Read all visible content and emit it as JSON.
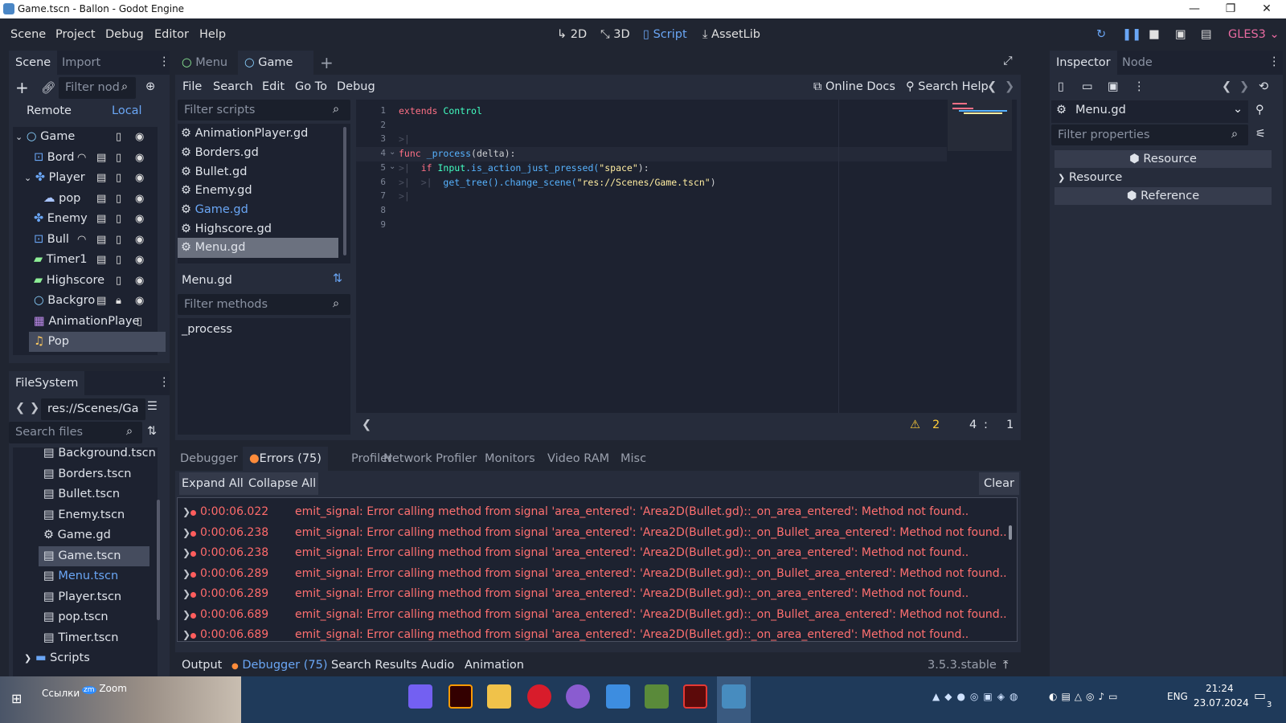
{
  "window": {
    "title": "Game.tscn - Ballon - Godot Engine",
    "minimize": "—",
    "restore": "❐",
    "close": "✕"
  },
  "menu": [
    "Scene",
    "Project",
    "Debug",
    "Editor",
    "Help"
  ],
  "workspaces": {
    "d2": "2D",
    "d3": "3D",
    "script": "Script",
    "assetlib": "AssetLib"
  },
  "renderer": "GLES3",
  "scene_dock": {
    "tab_scene": "Scene",
    "tab_import": "Import",
    "filter_placeholder": "Filter nod",
    "remote": "Remote",
    "local": "Local",
    "nodes": [
      {
        "name": "Game"
      },
      {
        "name": "Bord"
      },
      {
        "name": "Player"
      },
      {
        "name": "pop"
      },
      {
        "name": "Enemy"
      },
      {
        "name": "Bull"
      },
      {
        "name": "Timer1"
      },
      {
        "name": "Highscore"
      },
      {
        "name": "Backgro"
      },
      {
        "name": "AnimationPlaye"
      },
      {
        "name": "Pop"
      }
    ]
  },
  "filesystem": {
    "title": "FileSystem",
    "path": "res://Scenes/Ga",
    "search_placeholder": "Search files",
    "files": [
      "Background.tscn",
      "Borders.tscn",
      "Bullet.tscn",
      "Enemy.tscn",
      "Game.gd",
      "Game.tscn",
      "Menu.tscn",
      "Player.tscn",
      "pop.tscn",
      "Timer.tscn",
      "Scripts"
    ]
  },
  "scene_tabs": {
    "menu": "Menu",
    "game": "Game"
  },
  "script_menu": {
    "file": "File",
    "search": "Search",
    "edit": "Edit",
    "goto": "Go To",
    "debug": "Debug",
    "online_docs": "Online Docs",
    "search_help": "Search Help"
  },
  "scripts": {
    "filter_placeholder": "Filter scripts",
    "list": [
      "AnimationPlayer.gd",
      "Borders.gd",
      "Bullet.gd",
      "Enemy.gd",
      "Game.gd",
      "Highscore.gd",
      "Menu.gd"
    ],
    "current": "Menu.gd",
    "methods_placeholder": "Filter methods",
    "methods": [
      "_process"
    ]
  },
  "code": {
    "line_numbers": [
      "1",
      "2",
      "3",
      "4",
      "5",
      "6",
      "7",
      "8",
      "9"
    ],
    "l1_kw": "extends",
    "l1_ty": "Control",
    "l4_kw": "func",
    "l4_fn": "_process",
    "l4_rest": "(delta):",
    "l5_kw": "if",
    "l5_ty": "Input",
    "l5_fn": ".is_action_just_pressed(",
    "l5_st": "\"space\"",
    "l5_end": "):",
    "l6_fn": "get_tree().change_scene(",
    "l6_st": "\"res://Scenes/Game.tscn\"",
    "l6_end": ")",
    "warnings": "2",
    "line": "4",
    "col": "1"
  },
  "debugger": {
    "tabs": [
      "Debugger",
      "Errors (75)",
      "Profiler",
      "Network Profiler",
      "Monitors",
      "Video RAM",
      "Misc"
    ],
    "expand_all": "Expand All",
    "collapse_all": "Collapse All",
    "clear": "Clear",
    "errors": [
      {
        "time": "0:00:06.022",
        "msg": "emit_signal: Error calling method from signal 'area_entered': 'Area2D(Bullet.gd)::_on_area_entered': Method not found.."
      },
      {
        "time": "0:00:06.238",
        "msg": "emit_signal: Error calling method from signal 'area_entered': 'Area2D(Bullet.gd)::_on_Bullet_area_entered': Method not found.."
      },
      {
        "time": "0:00:06.238",
        "msg": "emit_signal: Error calling method from signal 'area_entered': 'Area2D(Bullet.gd)::_on_area_entered': Method not found.."
      },
      {
        "time": "0:00:06.289",
        "msg": "emit_signal: Error calling method from signal 'area_entered': 'Area2D(Bullet.gd)::_on_Bullet_area_entered': Method not found.."
      },
      {
        "time": "0:00:06.289",
        "msg": "emit_signal: Error calling method from signal 'area_entered': 'Area2D(Bullet.gd)::_on_area_entered': Method not found.."
      },
      {
        "time": "0:00:06.689",
        "msg": "emit_signal: Error calling method from signal 'area_entered': 'Area2D(Bullet.gd)::_on_Bullet_area_entered': Method not found.."
      },
      {
        "time": "0:00:06.689",
        "msg": "emit_signal: Error calling method from signal 'area_entered': 'Area2D(Bullet.gd)::_on_area_entered': Method not found.."
      }
    ]
  },
  "bottom_bar": {
    "output": "Output",
    "debugger": "Debugger (75)",
    "search_results": "Search Results",
    "audio": "Audio",
    "animation": "Animation",
    "version": "3.5.3.stable"
  },
  "inspector": {
    "tab_inspector": "Inspector",
    "tab_node": "Node",
    "object": "Menu.gd",
    "filter_placeholder": "Filter properties",
    "sections": [
      "Resource",
      "Resource",
      "Reference"
    ]
  },
  "taskbar": {
    "links": "Ссылки",
    "zoom": "Zoom",
    "lang": "ENG",
    "time": "21:24",
    "date": "23.07.2024",
    "notif": "3"
  }
}
